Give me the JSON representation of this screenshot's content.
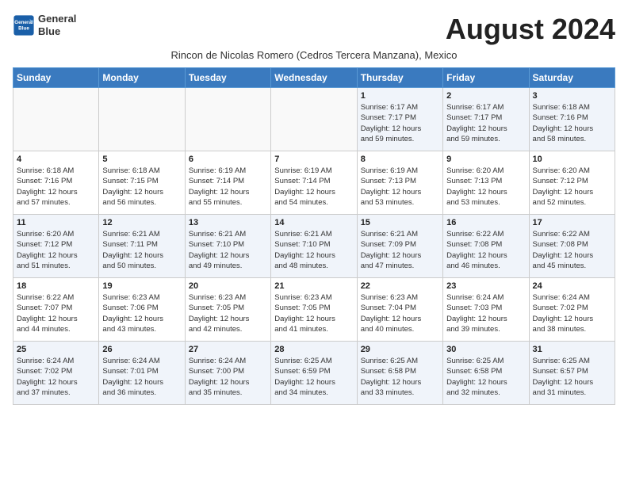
{
  "header": {
    "logo_line1": "General",
    "logo_line2": "Blue",
    "month_title": "August 2024",
    "subtitle": "Rincon de Nicolas Romero (Cedros Tercera Manzana), Mexico"
  },
  "weekdays": [
    "Sunday",
    "Monday",
    "Tuesday",
    "Wednesday",
    "Thursday",
    "Friday",
    "Saturday"
  ],
  "weeks": [
    [
      {
        "day": "",
        "info": ""
      },
      {
        "day": "",
        "info": ""
      },
      {
        "day": "",
        "info": ""
      },
      {
        "day": "",
        "info": ""
      },
      {
        "day": "1",
        "info": "Sunrise: 6:17 AM\nSunset: 7:17 PM\nDaylight: 12 hours\nand 59 minutes."
      },
      {
        "day": "2",
        "info": "Sunrise: 6:17 AM\nSunset: 7:17 PM\nDaylight: 12 hours\nand 59 minutes."
      },
      {
        "day": "3",
        "info": "Sunrise: 6:18 AM\nSunset: 7:16 PM\nDaylight: 12 hours\nand 58 minutes."
      }
    ],
    [
      {
        "day": "4",
        "info": "Sunrise: 6:18 AM\nSunset: 7:16 PM\nDaylight: 12 hours\nand 57 minutes."
      },
      {
        "day": "5",
        "info": "Sunrise: 6:18 AM\nSunset: 7:15 PM\nDaylight: 12 hours\nand 56 minutes."
      },
      {
        "day": "6",
        "info": "Sunrise: 6:19 AM\nSunset: 7:14 PM\nDaylight: 12 hours\nand 55 minutes."
      },
      {
        "day": "7",
        "info": "Sunrise: 6:19 AM\nSunset: 7:14 PM\nDaylight: 12 hours\nand 54 minutes."
      },
      {
        "day": "8",
        "info": "Sunrise: 6:19 AM\nSunset: 7:13 PM\nDaylight: 12 hours\nand 53 minutes."
      },
      {
        "day": "9",
        "info": "Sunrise: 6:20 AM\nSunset: 7:13 PM\nDaylight: 12 hours\nand 53 minutes."
      },
      {
        "day": "10",
        "info": "Sunrise: 6:20 AM\nSunset: 7:12 PM\nDaylight: 12 hours\nand 52 minutes."
      }
    ],
    [
      {
        "day": "11",
        "info": "Sunrise: 6:20 AM\nSunset: 7:12 PM\nDaylight: 12 hours\nand 51 minutes."
      },
      {
        "day": "12",
        "info": "Sunrise: 6:21 AM\nSunset: 7:11 PM\nDaylight: 12 hours\nand 50 minutes."
      },
      {
        "day": "13",
        "info": "Sunrise: 6:21 AM\nSunset: 7:10 PM\nDaylight: 12 hours\nand 49 minutes."
      },
      {
        "day": "14",
        "info": "Sunrise: 6:21 AM\nSunset: 7:10 PM\nDaylight: 12 hours\nand 48 minutes."
      },
      {
        "day": "15",
        "info": "Sunrise: 6:21 AM\nSunset: 7:09 PM\nDaylight: 12 hours\nand 47 minutes."
      },
      {
        "day": "16",
        "info": "Sunrise: 6:22 AM\nSunset: 7:08 PM\nDaylight: 12 hours\nand 46 minutes."
      },
      {
        "day": "17",
        "info": "Sunrise: 6:22 AM\nSunset: 7:08 PM\nDaylight: 12 hours\nand 45 minutes."
      }
    ],
    [
      {
        "day": "18",
        "info": "Sunrise: 6:22 AM\nSunset: 7:07 PM\nDaylight: 12 hours\nand 44 minutes."
      },
      {
        "day": "19",
        "info": "Sunrise: 6:23 AM\nSunset: 7:06 PM\nDaylight: 12 hours\nand 43 minutes."
      },
      {
        "day": "20",
        "info": "Sunrise: 6:23 AM\nSunset: 7:05 PM\nDaylight: 12 hours\nand 42 minutes."
      },
      {
        "day": "21",
        "info": "Sunrise: 6:23 AM\nSunset: 7:05 PM\nDaylight: 12 hours\nand 41 minutes."
      },
      {
        "day": "22",
        "info": "Sunrise: 6:23 AM\nSunset: 7:04 PM\nDaylight: 12 hours\nand 40 minutes."
      },
      {
        "day": "23",
        "info": "Sunrise: 6:24 AM\nSunset: 7:03 PM\nDaylight: 12 hours\nand 39 minutes."
      },
      {
        "day": "24",
        "info": "Sunrise: 6:24 AM\nSunset: 7:02 PM\nDaylight: 12 hours\nand 38 minutes."
      }
    ],
    [
      {
        "day": "25",
        "info": "Sunrise: 6:24 AM\nSunset: 7:02 PM\nDaylight: 12 hours\nand 37 minutes."
      },
      {
        "day": "26",
        "info": "Sunrise: 6:24 AM\nSunset: 7:01 PM\nDaylight: 12 hours\nand 36 minutes."
      },
      {
        "day": "27",
        "info": "Sunrise: 6:24 AM\nSunset: 7:00 PM\nDaylight: 12 hours\nand 35 minutes."
      },
      {
        "day": "28",
        "info": "Sunrise: 6:25 AM\nSunset: 6:59 PM\nDaylight: 12 hours\nand 34 minutes."
      },
      {
        "day": "29",
        "info": "Sunrise: 6:25 AM\nSunset: 6:58 PM\nDaylight: 12 hours\nand 33 minutes."
      },
      {
        "day": "30",
        "info": "Sunrise: 6:25 AM\nSunset: 6:58 PM\nDaylight: 12 hours\nand 32 minutes."
      },
      {
        "day": "31",
        "info": "Sunrise: 6:25 AM\nSunset: 6:57 PM\nDaylight: 12 hours\nand 31 minutes."
      }
    ]
  ]
}
